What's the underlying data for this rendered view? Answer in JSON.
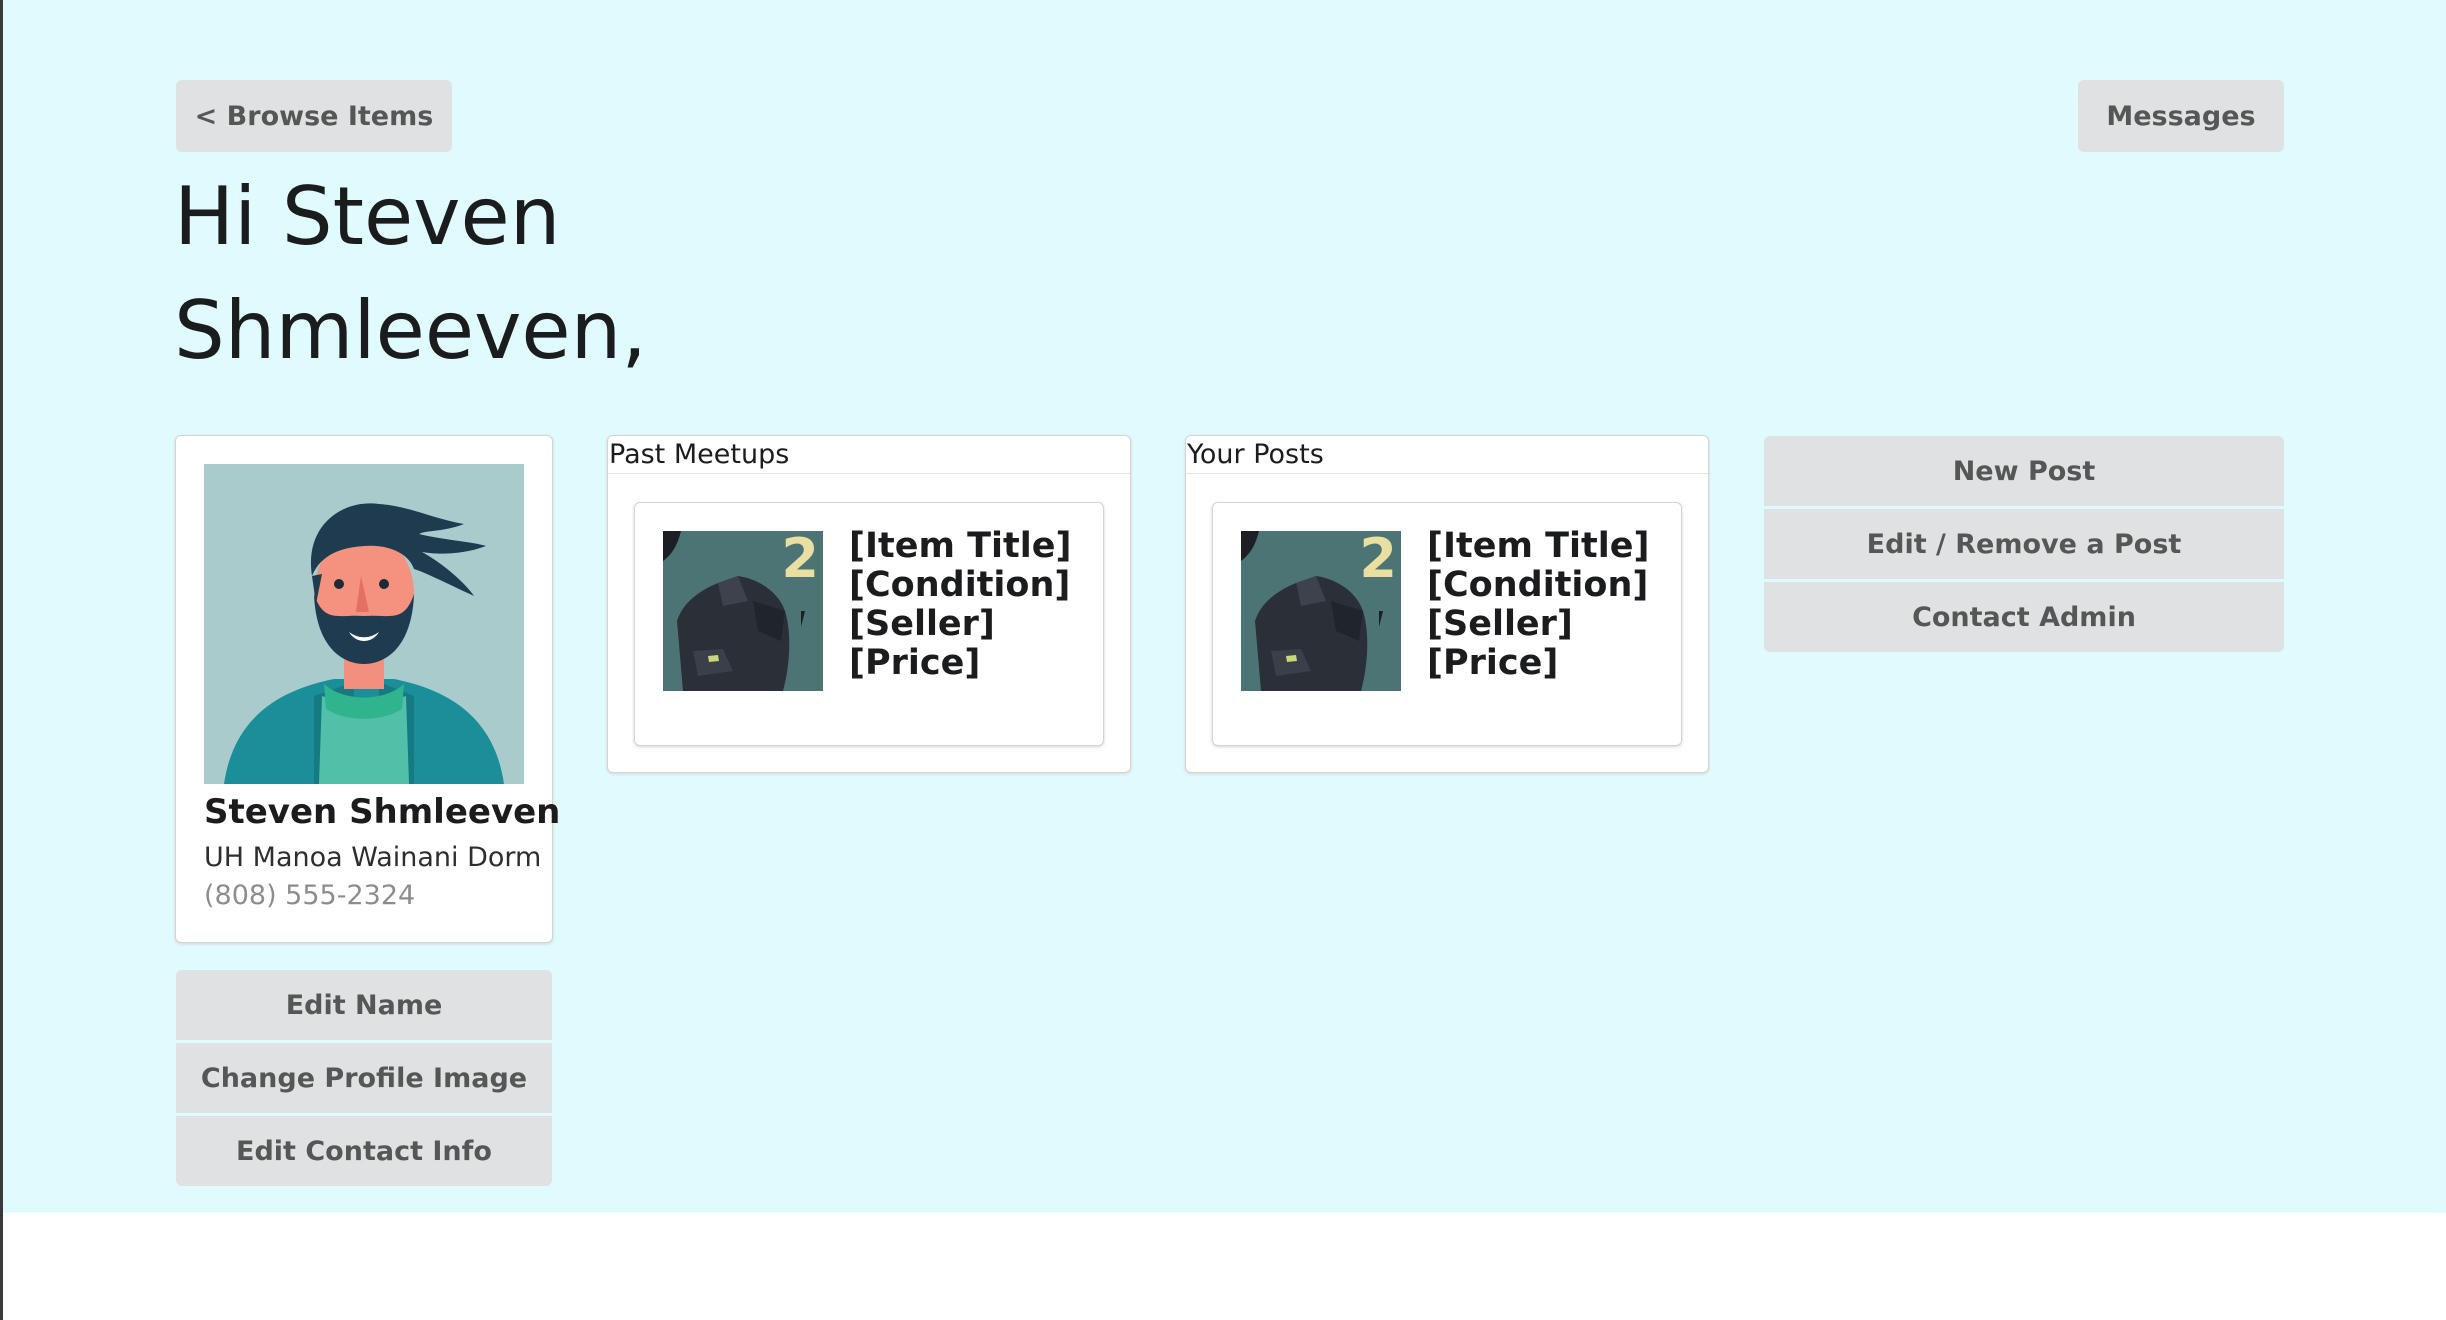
{
  "nav": {
    "browse_label": "< Browse Items",
    "messages_label": "Messages"
  },
  "greeting": {
    "line1": "Hi Steven",
    "line2": "Shmleeven,"
  },
  "profile": {
    "name": "Steven Shmleeven",
    "location": "UH Manoa Wainani Dorm",
    "phone": "(808) 555-2324",
    "image_icon": "avatar-illustration",
    "actions": [
      "Edit Name",
      "Change Profile Image",
      "Edit Contact Info"
    ]
  },
  "past_meetups": {
    "title": "Past Meetups",
    "item": {
      "thumb_icon": "item-thumbnail",
      "thumb_badge": "2",
      "title": "[Item Title]",
      "condition": "[Condition]",
      "seller": "[Seller]",
      "price": "[Price]"
    }
  },
  "your_posts": {
    "title": "Your Posts",
    "item": {
      "thumb_icon": "item-thumbnail",
      "thumb_badge": "2",
      "title": "[Item Title]",
      "condition": "[Condition]",
      "seller": "[Seller]",
      "price": "[Price]"
    }
  },
  "post_actions": [
    "New Post",
    "Edit / Remove a Post",
    "Contact Admin"
  ],
  "colors": {
    "background": "#e0fbfe",
    "button": "#e0e1e2",
    "card_border": "#d4d4d5"
  }
}
